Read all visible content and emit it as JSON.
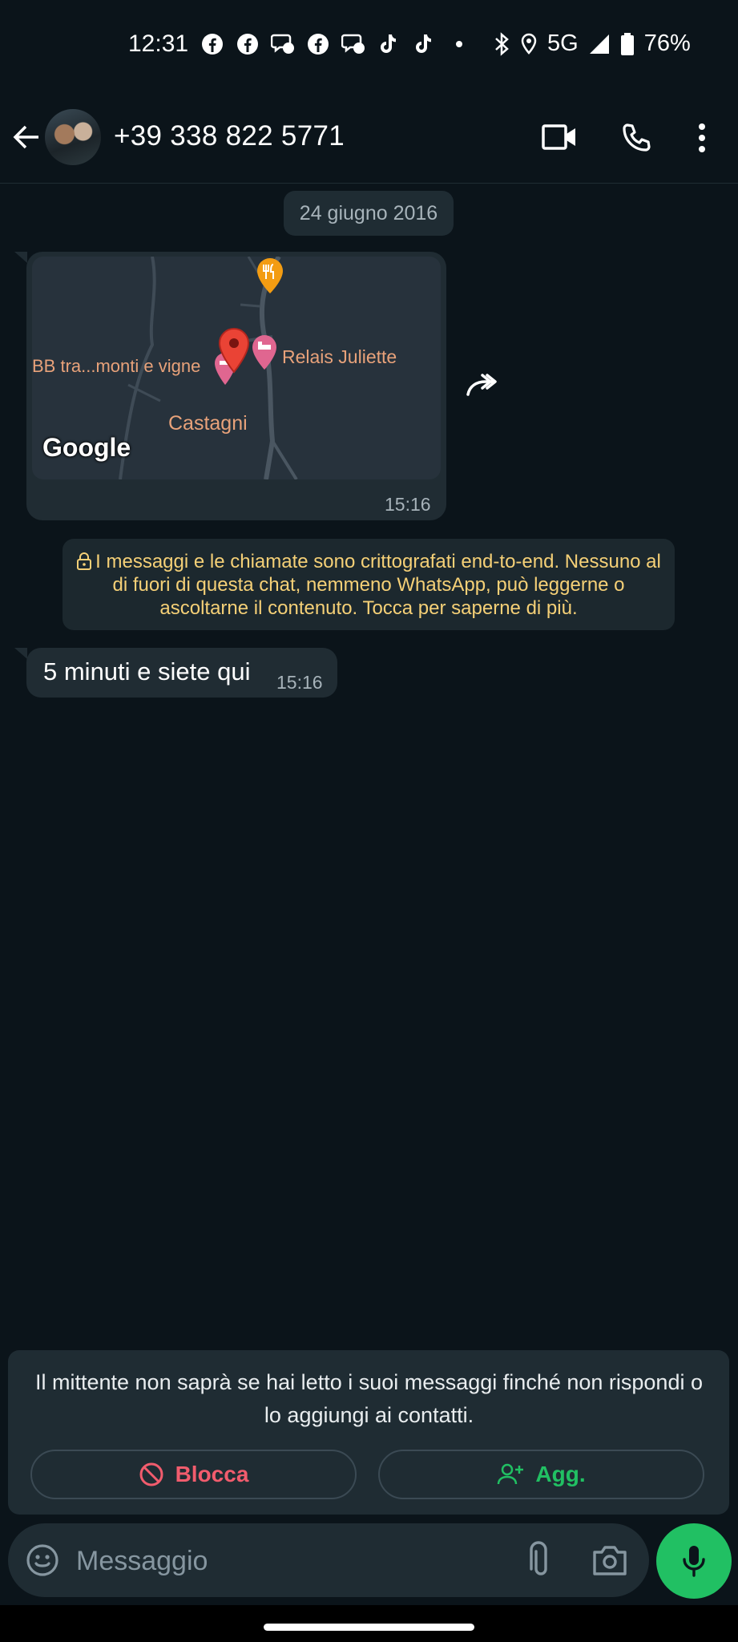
{
  "status_bar": {
    "time": "12:31",
    "network": "5G",
    "battery": "76%",
    "notification_icons": [
      "facebook-icon",
      "facebook-icon",
      "messenger-icon",
      "facebook-icon",
      "messenger-icon",
      "tiktok-icon",
      "tiktok-icon",
      "dot-icon"
    ]
  },
  "header": {
    "contact_name": "+39 338 822 5771"
  },
  "chat": {
    "date_chip": "24 giugno 2016",
    "location_message": {
      "map_labels": {
        "place1": "BB tra...monti e vigne",
        "place2": "Relais Juliette",
        "village": "Castagni",
        "attribution": "Google"
      },
      "time": "15:16"
    },
    "encryption_notice": "I messaggi e le chiamate sono crittografati end-to-end. Nessuno al di fuori di questa chat, nemmeno WhatsApp, può leggerne o ascoltarne il contenuto. Tocca per saperne di più.",
    "text_message": {
      "text": "5 minuti e siete qui",
      "time": "15:16"
    }
  },
  "unknown_sender_panel": {
    "text": "Il mittente non saprà se hai letto i suoi messaggi finché non rispondi o lo aggiungi ai contatti.",
    "block_label": "Blocca",
    "add_label": "Agg."
  },
  "composer": {
    "placeholder": "Messaggio"
  },
  "colors": {
    "background": "#0b141a",
    "bubble": "#202c33",
    "accent_green": "#21c063",
    "block_red": "#f15c6d",
    "notice_yellow": "#f5d077"
  }
}
